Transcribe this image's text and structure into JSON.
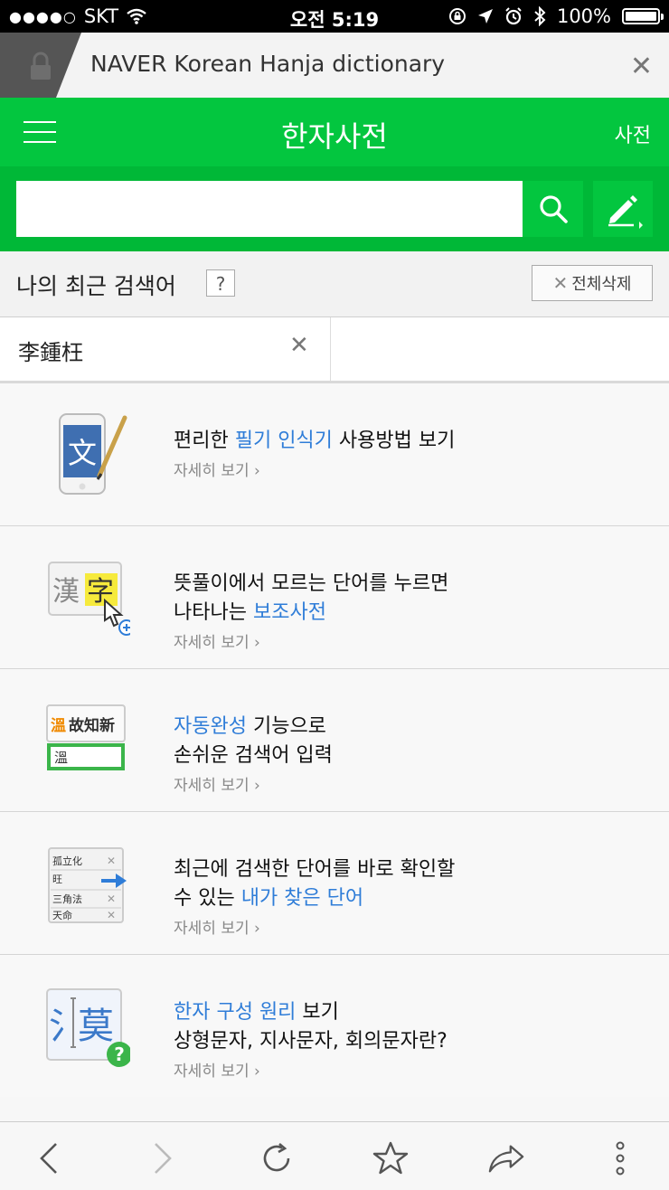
{
  "status_bar": {
    "signal_dots": "●●●●○",
    "carrier": "SKT",
    "time": "오전 5:19",
    "battery": "100%"
  },
  "browser": {
    "title": "NAVER Korean Hanja dictionary",
    "close_label": "✕"
  },
  "header": {
    "title": "한자사전",
    "right_link": "사전"
  },
  "search": {
    "placeholder": ""
  },
  "recent": {
    "title": "나의 최근 검색어",
    "help": "?",
    "delete_all": "전체삭제",
    "items": [
      {
        "word": "李鍾枉"
      }
    ]
  },
  "features": [
    {
      "line1_pre": "편리한 ",
      "line1_hl": "필기 인식기",
      "line1_post": " 사용방법 보기",
      "line2_pre": "",
      "line2_hl": "",
      "line2_post": "",
      "more": "자세히 보기 ›"
    },
    {
      "line1_pre": "뜻풀이에서 모르는 단어를 누르면",
      "line1_hl": "",
      "line1_post": "",
      "line2_pre": "나타나는 ",
      "line2_hl": "보조사전",
      "line2_post": "",
      "more": "자세히 보기 ›"
    },
    {
      "line1_pre": "",
      "line1_hl": "자동완성",
      "line1_post": " 기능으로",
      "line2_pre": "손쉬운 검색어 입력",
      "line2_hl": "",
      "line2_post": "",
      "more": "자세히 보기 ›"
    },
    {
      "line1_pre": "최근에 검색한 단어를 바로 확인할",
      "line1_hl": "",
      "line1_post": "",
      "line2_pre": "수 있는 ",
      "line2_hl": "내가 찾은 단어",
      "line2_post": "",
      "more": "자세히 보기 ›"
    },
    {
      "line1_pre": "",
      "line1_hl": "한자 구성 원리",
      "line1_post": " 보기",
      "line2_pre": "상형문자, 지사문자, 회의문자란?",
      "line2_hl": "",
      "line2_post": "",
      "more": "자세히 보기 ›"
    }
  ],
  "icon_text": {
    "f1": "文",
    "f2_a": "漢",
    "f2_b": "字",
    "f3_a": "溫",
    "f3_b": "故知新",
    "f3_c": "溫",
    "f4_rows": [
      "孤立化",
      "旺",
      "三角法",
      "天命"
    ],
    "f5_a": "氵",
    "f5_b": "莫",
    "f5_q": "?"
  },
  "colors": {
    "naver_green": "#03c63f",
    "highlight_blue": "#2f7dd8"
  }
}
